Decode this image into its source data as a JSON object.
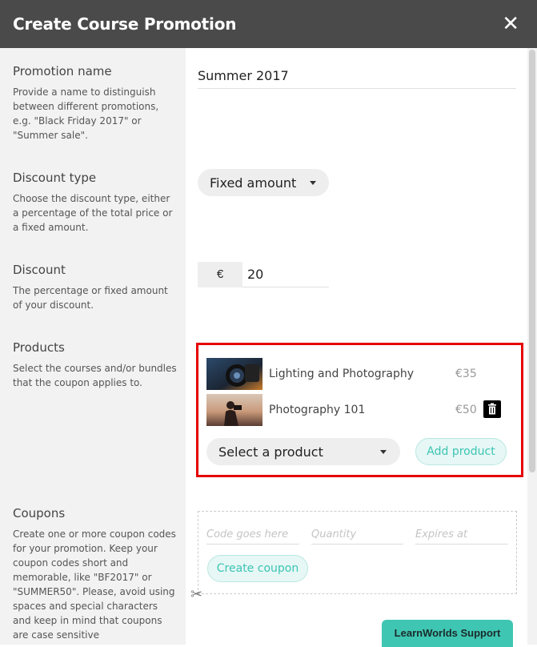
{
  "modal": {
    "title": "Create Course Promotion",
    "close_symbol": "✕"
  },
  "sections": {
    "promotion_name": {
      "heading": "Promotion name",
      "description": "Provide a name to distinguish between different promotions, e.g. \"Black Friday 2017\" or \"Summer sale\".",
      "value": "Summer 2017"
    },
    "discount_type": {
      "heading": "Discount type",
      "description": "Choose the discount type, either a percentage of the total price or a fixed amount.",
      "selected": "Fixed amount"
    },
    "discount": {
      "heading": "Discount",
      "description": "The percentage or fixed amount of your discount.",
      "currency": "€",
      "value": "20"
    },
    "products": {
      "heading": "Products",
      "description": "Select the courses and/or bundles that the coupon applies to.",
      "items": [
        {
          "name": "Lighting and Photography",
          "price": "€35",
          "thumb_icon": "camera-lens-photo"
        },
        {
          "name": "Photography 101",
          "price": "€50",
          "thumb_icon": "photographer-sunset-photo"
        }
      ],
      "select_placeholder": "Select a product",
      "add_label": "Add product",
      "highlight_color": "#e60000"
    },
    "coupons": {
      "heading": "Coupons",
      "description": "Create one or more coupon codes for your promotion. Keep your coupon codes short and memorable, like \"BF2017\" or \"SUMMER50\". Please, avoid using spaces and special characters and keep in mind that coupons are case sensitive",
      "code_placeholder": "Code goes here",
      "quantity_placeholder": "Quantity",
      "expires_placeholder": "Expires at",
      "create_label": "Create coupon"
    }
  },
  "support": {
    "label": "LearnWorlds Support"
  },
  "colors": {
    "header_bg": "#4a4a4a",
    "accent": "#3cc4b4",
    "support_bg": "#3fc6b3"
  }
}
